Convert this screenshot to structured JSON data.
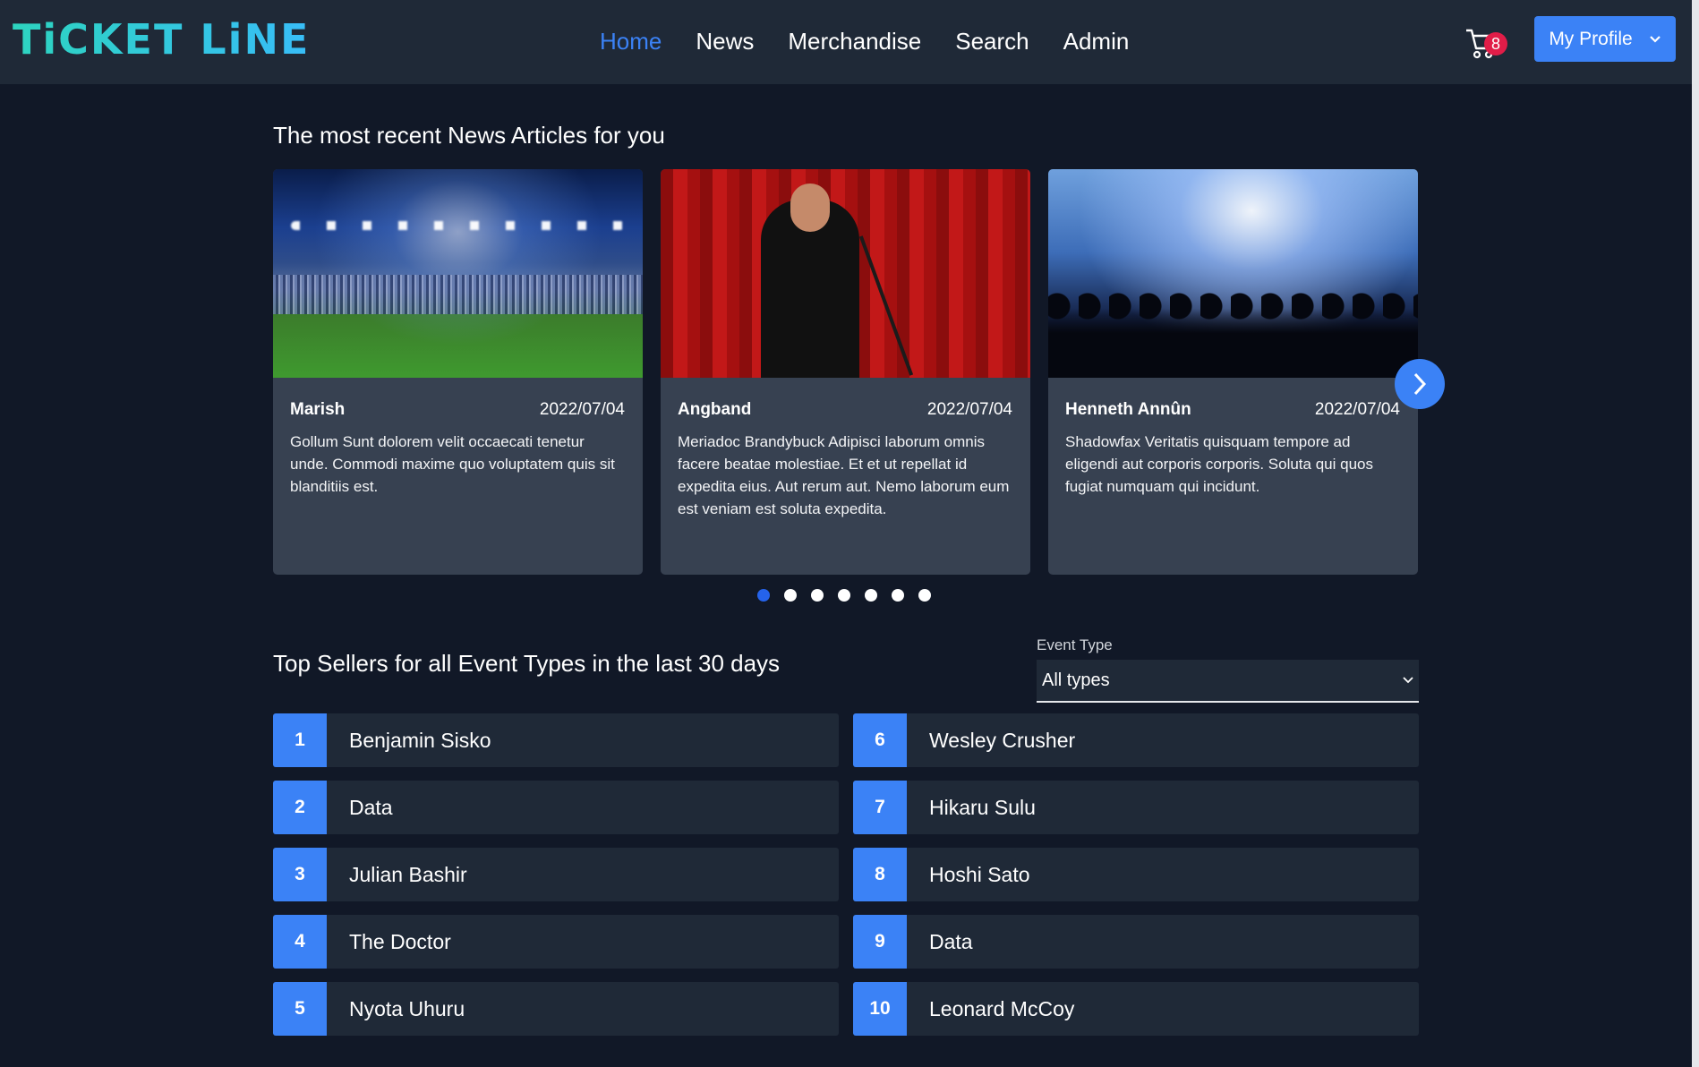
{
  "brand": {
    "logo_text": "TiCKET LiNE"
  },
  "nav": {
    "items": [
      {
        "label": "Home",
        "active": true
      },
      {
        "label": "News"
      },
      {
        "label": "Merchandise"
      },
      {
        "label": "Search"
      },
      {
        "label": "Admin"
      }
    ],
    "cart_icon": "cart-icon",
    "cart_count": "8",
    "profile_label": "My Profile"
  },
  "news": {
    "title": "The most recent News Articles for you",
    "articles": [
      {
        "title": "Marish",
        "date": "2022/07/04",
        "text": "Gollum Sunt dolorem velit occaecati tenetur unde. Commodi maxime quo voluptatem quis sit blanditiis est.",
        "image": "stadium-image"
      },
      {
        "title": "Angband",
        "date": "2022/07/04",
        "text": "Meriadoc Brandybuck Adipisci laborum omnis facere beatae molestiae. Et et ut repellat id expedita eius. Aut rerum aut. Nemo laborum eum est veniam est soluta expedita.",
        "image": "comedian-image"
      },
      {
        "title": "Henneth Annûn",
        "date": "2022/07/04",
        "text": "Shadowfax Veritatis quisquam tempore ad eligendi aut corporis corporis. Soluta qui quos fugiat numquam qui incidunt.",
        "image": "concert-image"
      }
    ],
    "next_icon": "chevron-right-icon",
    "pages": 7,
    "active_page": 1
  },
  "sellers": {
    "title": "Top Sellers for all Event Types in the last 30 days",
    "filter_label": "Event Type",
    "filter_value": "All types",
    "list": [
      {
        "rank": "1",
        "name": "Benjamin Sisko"
      },
      {
        "rank": "6",
        "name": "Wesley Crusher"
      },
      {
        "rank": "2",
        "name": "Data"
      },
      {
        "rank": "7",
        "name": "Hikaru Sulu"
      },
      {
        "rank": "3",
        "name": "Julian Bashir"
      },
      {
        "rank": "8",
        "name": "Hoshi Sato"
      },
      {
        "rank": "4",
        "name": "The Doctor"
      },
      {
        "rank": "9",
        "name": "Data"
      },
      {
        "rank": "5",
        "name": "Nyota Uhuru"
      },
      {
        "rank": "10",
        "name": "Leonard McCoy"
      }
    ]
  },
  "colors": {
    "accent": "#3b82f6",
    "background": "#111827",
    "panel": "#1f2937",
    "card": "#374151",
    "badge": "#e11d48"
  }
}
